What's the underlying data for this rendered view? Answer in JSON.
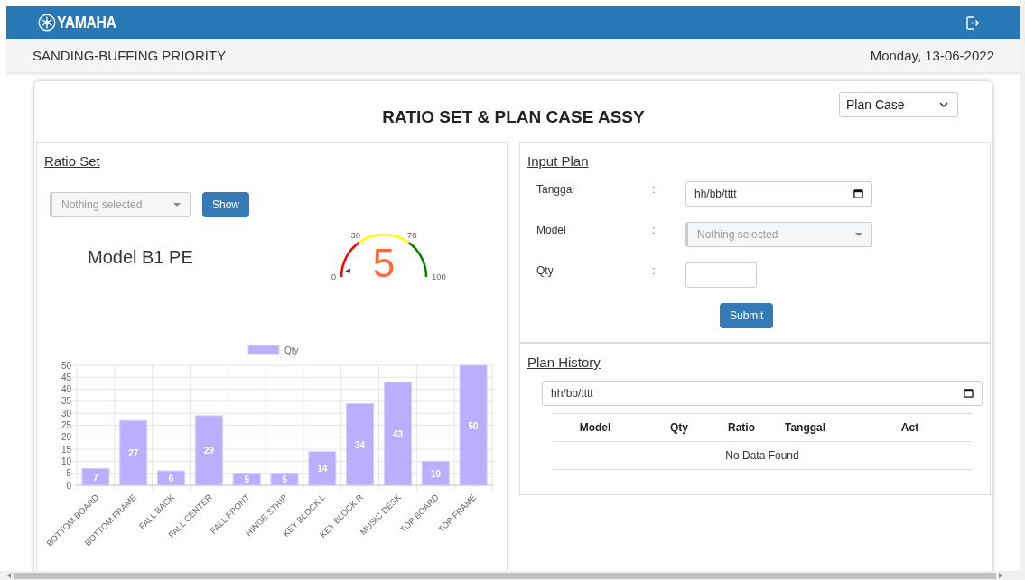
{
  "header": {
    "brand": "YAMAHA"
  },
  "subheader": {
    "title": "SANDING-BUFFING PRIORITY",
    "date": "Monday, 13-06-2022"
  },
  "page": {
    "title": "RATIO SET & PLAN CASE ASSY",
    "mode_select": "Plan Case"
  },
  "ratio_set": {
    "heading": "Ratio Set",
    "model_select": {
      "placeholder": "Nothing selected"
    },
    "show_button": "Show",
    "model_name": "Model B1 PE",
    "gauge": {
      "value": "5",
      "ticks": [
        "0",
        "30",
        "70",
        "100"
      ],
      "bands": [
        {
          "color": "#ff0000"
        },
        {
          "color": "#ffff00"
        },
        {
          "color": "#008000"
        }
      ]
    },
    "chart_data": {
      "type": "bar",
      "categories": [
        "BOTTOM BOARD",
        "BOTTOM FRAME",
        "FALL BACK",
        "FALL CENTER",
        "FALL FRONT",
        "HINGE STRIP",
        "KEY BLOCK L",
        "KEY BLOCK R",
        "MUSIC DESK",
        "TOP BOARD",
        "TOP FRAME"
      ],
      "series": [
        {
          "name": "Qty",
          "color": "#bbaefc",
          "values": [
            7,
            27,
            6,
            29,
            5,
            5,
            14,
            34,
            43,
            10,
            50
          ]
        }
      ],
      "ylim": [
        0,
        50
      ],
      "yticks": [
        0,
        5,
        10,
        15,
        20,
        25,
        30,
        35,
        40,
        45,
        50
      ],
      "grid": true,
      "data_labels": true
    }
  },
  "input_plan": {
    "heading": "Input Plan",
    "fields": [
      {
        "label": "Tanggal",
        "separator": ":",
        "kind": "date",
        "value": "hh/bb/tttt"
      },
      {
        "label": "Model",
        "separator": ":",
        "kind": "select",
        "placeholder": "Nothing selected"
      },
      {
        "label": "Qty",
        "separator": ":",
        "kind": "number"
      }
    ],
    "submit_button": "Submit"
  },
  "plan_history": {
    "heading": "Plan History",
    "date_filter": {
      "value": "hh/bb/tttt"
    },
    "table": {
      "columns": [
        "Model",
        "Qty",
        "Ratio",
        "Tanggal",
        "Act"
      ],
      "empty_message": "No Data Found"
    }
  }
}
